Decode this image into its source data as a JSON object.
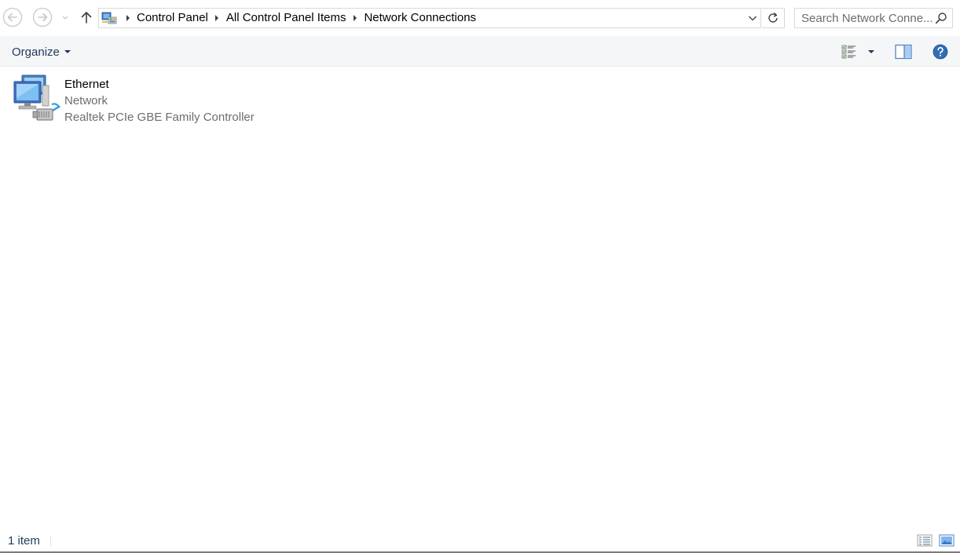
{
  "window": {
    "title": "Network Connections"
  },
  "navigation": {
    "back_icon": "back-arrow-icon",
    "forward_icon": "forward-arrow-icon",
    "recent_icon": "chevron-down-icon",
    "up_icon": "up-arrow-icon"
  },
  "address_bar": {
    "icon": "control-panel-icon",
    "breadcrumbs": [
      {
        "label": "Control Panel"
      },
      {
        "label": "All Control Panel Items"
      },
      {
        "label": "Network Connections"
      }
    ]
  },
  "search": {
    "placeholder": "Search Network Conne..."
  },
  "command_bar": {
    "organize_label": "Organize",
    "view_icon": "change-view-icon",
    "preview_pane_icon": "preview-pane-icon",
    "help_icon": "help-icon"
  },
  "connections": [
    {
      "name": "Ethernet",
      "status": "Network",
      "device": "Realtek PCIe GBE Family Controller",
      "icon": "ethernet-adapter-icon"
    }
  ],
  "status_bar": {
    "item_count": "1 item"
  },
  "colors": {
    "accent_text": "#1e395b",
    "secondary_text": "#6d6d6d",
    "command_bar_bg": "#f5f6f7",
    "border": "#d9d9d9",
    "help_blue": "#2f6fb5"
  }
}
